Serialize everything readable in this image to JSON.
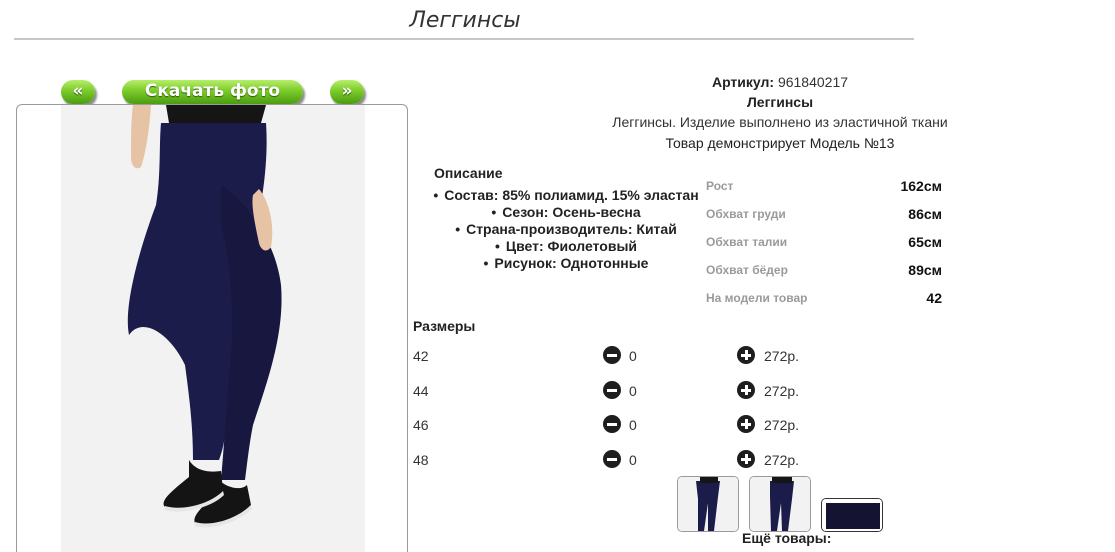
{
  "page": {
    "title": "Леггинсы"
  },
  "buttons": {
    "prev": "«",
    "download": "Скачать фото",
    "next": "»"
  },
  "product": {
    "article_label": "Артикул:",
    "article_value": "961840217",
    "name": "Леггинсы",
    "description": "Леггинсы. Изделие выполнено из эластичной ткани",
    "model_text": "Товар демонстрирует Модель №13"
  },
  "description": {
    "heading": "Описание",
    "items": [
      "Состав: 85% полиамид. 15% эластан",
      "Сезон: Осень-весна",
      "Страна-производитель: Китай",
      "Цвет: Фиолетовый",
      "Рисунок: Однотонные"
    ]
  },
  "model_params": [
    {
      "label": "Рост",
      "value": "162см"
    },
    {
      "label": "Обхват груди",
      "value": "86см"
    },
    {
      "label": "Обхват талии",
      "value": "65см"
    },
    {
      "label": "Обхват бёдер",
      "value": "89см"
    },
    {
      "label": "На модели товар",
      "value": "42"
    }
  ],
  "sizes": {
    "heading": "Размеры",
    "rows": [
      {
        "size": "42",
        "qty": "0",
        "price": "272р."
      },
      {
        "size": "44",
        "qty": "0",
        "price": "272р."
      },
      {
        "size": "46",
        "qty": "0",
        "price": "272р."
      },
      {
        "size": "48",
        "qty": "0",
        "price": "272р."
      }
    ]
  },
  "more_goods": "Ещё товары:",
  "colors": {
    "accent_green": "#7ccb2b",
    "leggings_navy": "#1c1c4a"
  },
  "icons": {
    "minus": "minus-circle-icon",
    "plus": "plus-circle-icon"
  }
}
